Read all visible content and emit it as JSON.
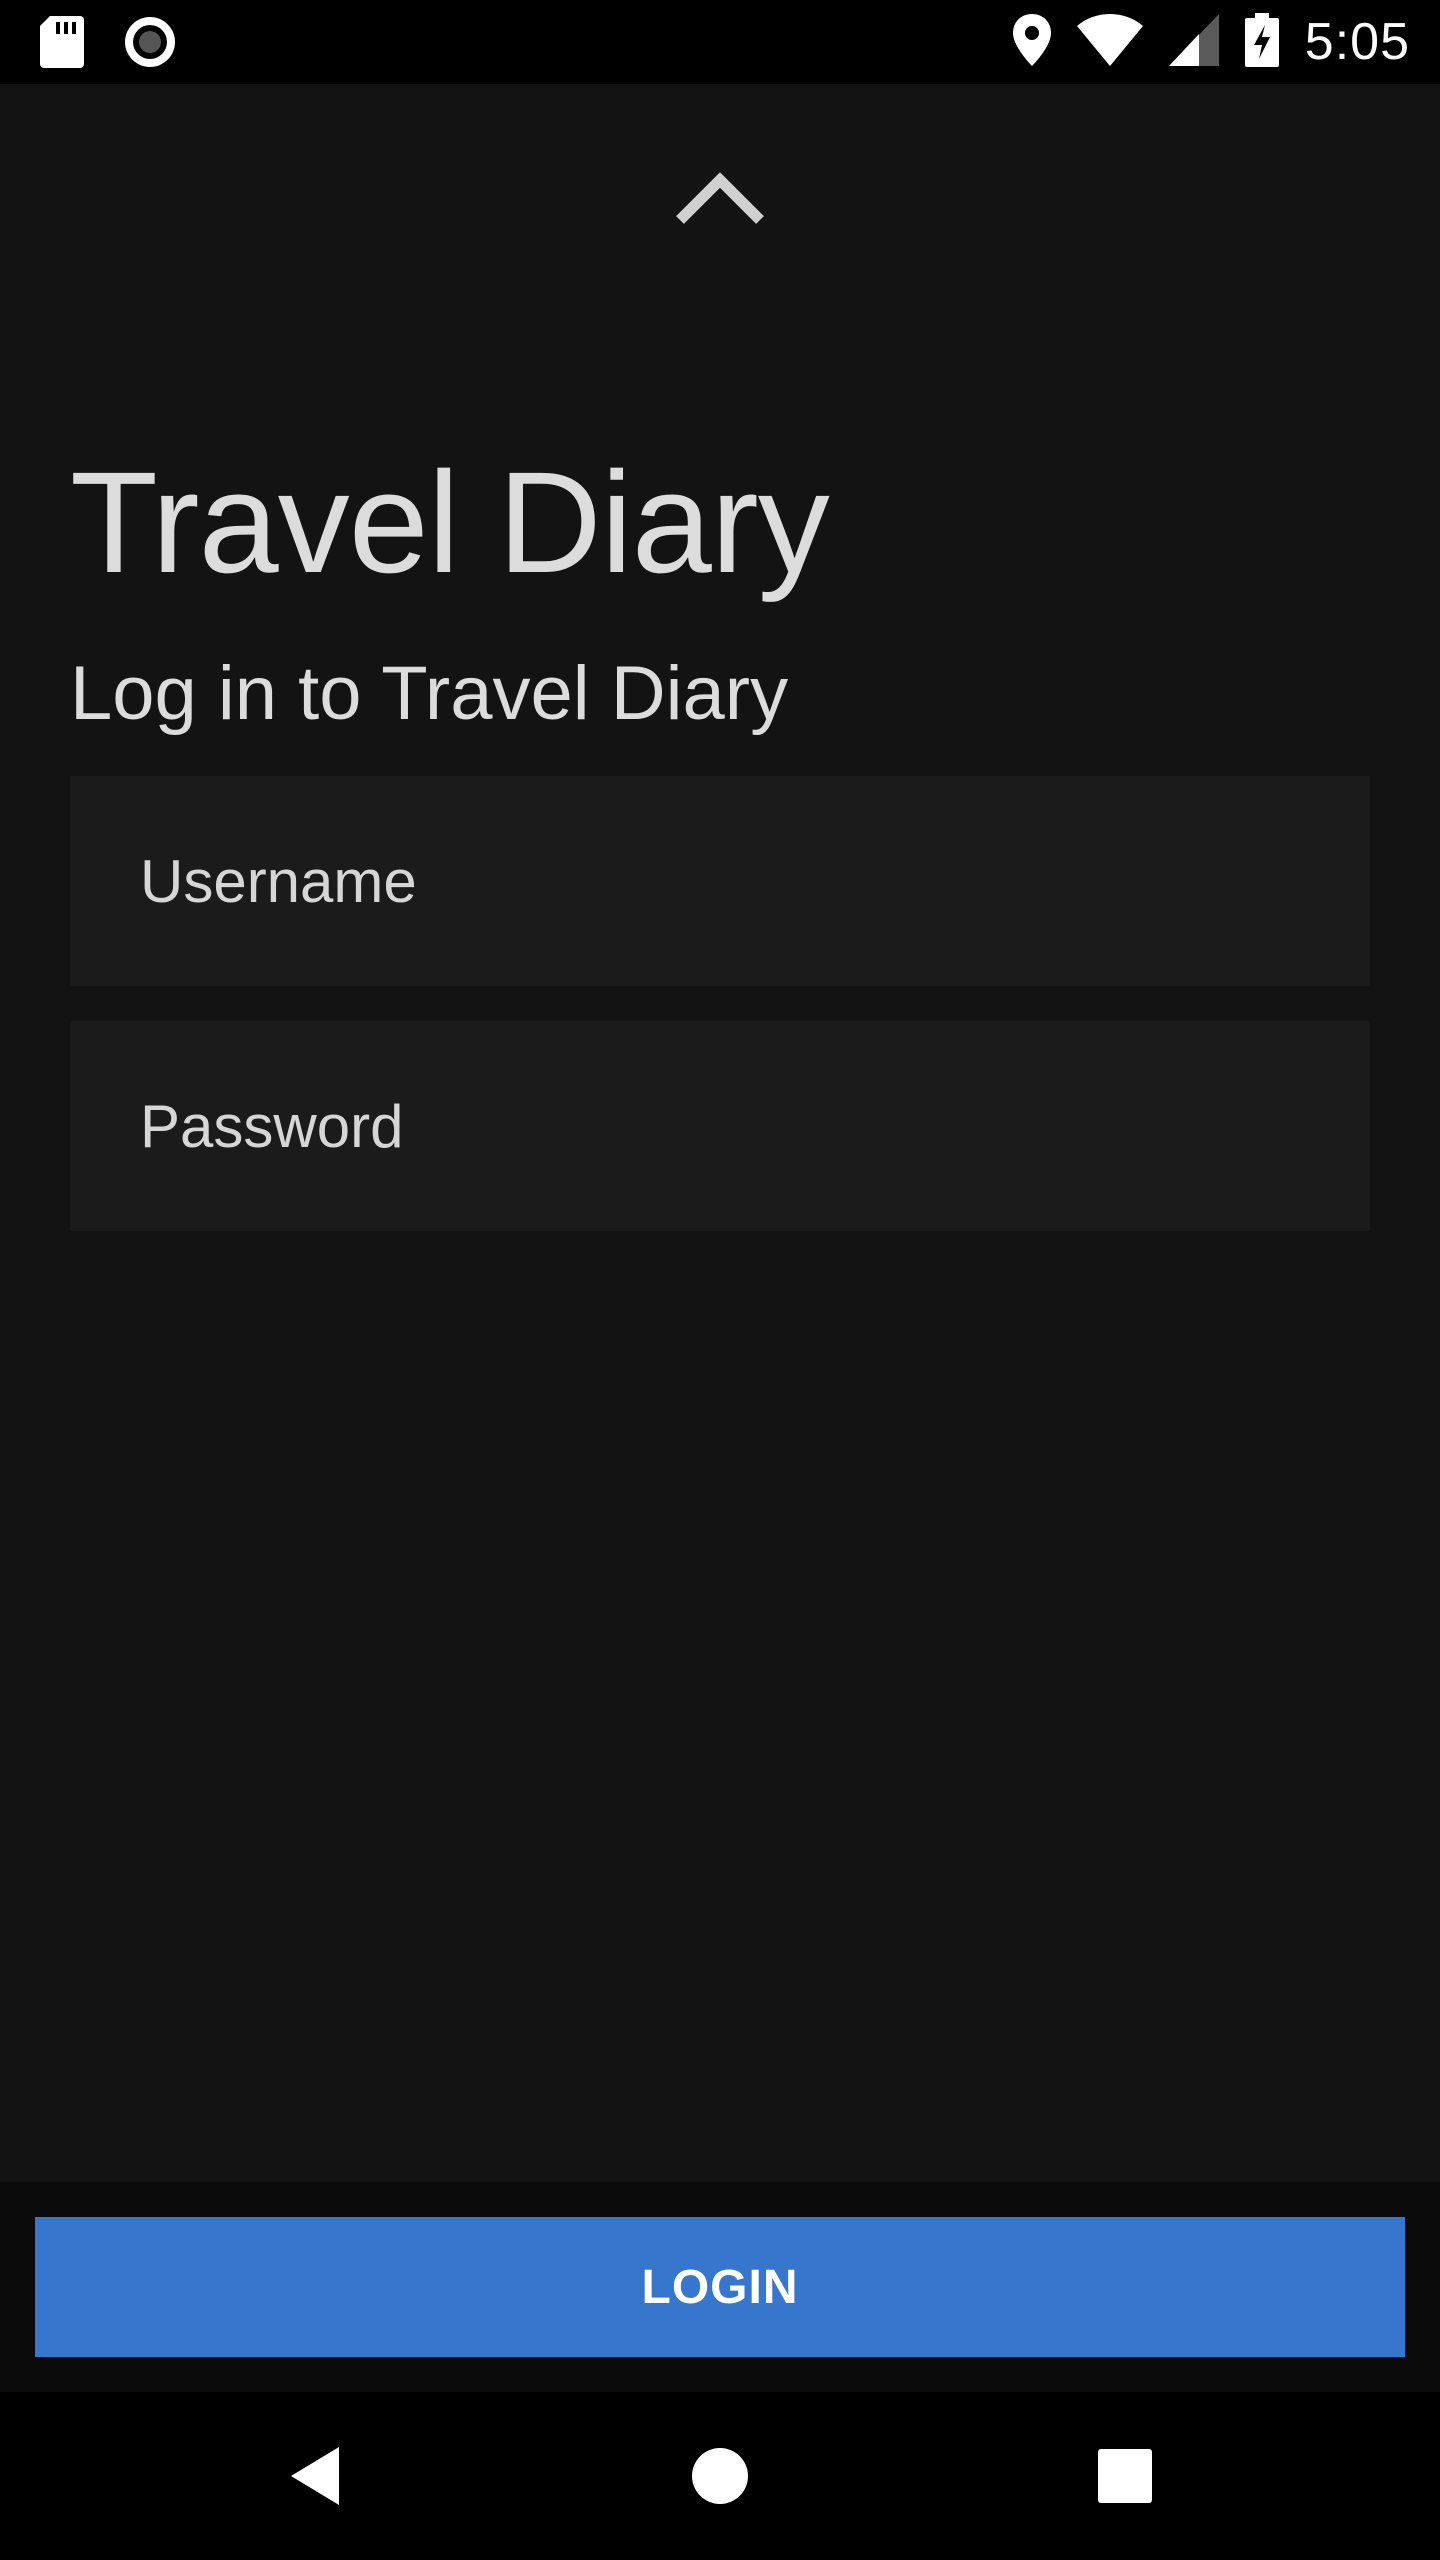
{
  "status_bar": {
    "time": "5:05",
    "icons_left": [
      "sd-card-icon",
      "record-icon"
    ],
    "icons_right": [
      "location-icon",
      "wifi-icon",
      "signal-icon",
      "battery-charging-icon"
    ]
  },
  "header": {
    "collapse_icon": "chevron-up-icon"
  },
  "login": {
    "app_title": "Travel Diary",
    "subtitle": "Log in to Travel Diary",
    "username_placeholder": "Username",
    "password_placeholder": "Password",
    "button_label": "LOGIN"
  },
  "nav_bar": {
    "icons": [
      "back-icon",
      "home-icon",
      "recents-icon"
    ]
  },
  "colors": {
    "background": "#131313",
    "field_background": "#1b1b1b",
    "primary_button": "#3676cd",
    "text": "#dcdcdc"
  }
}
